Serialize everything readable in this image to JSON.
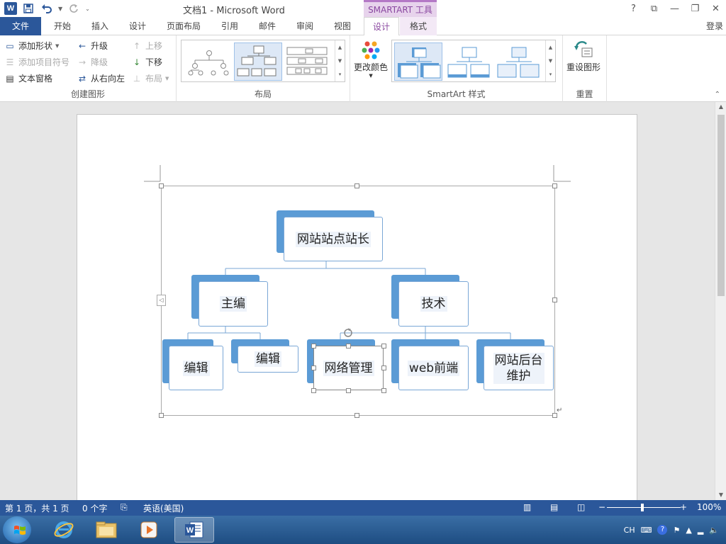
{
  "titlebar": {
    "doc_title": "文档1 - Microsoft Word",
    "context_tool_group": "SMARTART 工具",
    "controls": {
      "help": "?",
      "ribbon_display": "⧉",
      "minimize": "—",
      "restore": "❐",
      "close": "✕"
    }
  },
  "qat": {
    "word_logo": "W",
    "save_icon": "save-icon",
    "undo_icon": "undo-icon",
    "redo_icon": "redo-icon"
  },
  "tabs": {
    "file": "文件",
    "home": "开始",
    "insert": "插入",
    "design": "设计",
    "layout": "页面布局",
    "references": "引用",
    "mailings": "邮件",
    "review": "审阅",
    "view": "视图",
    "sa_design": "设计",
    "sa_format": "格式",
    "login": "登录"
  },
  "ribbon": {
    "create_graphic": {
      "add_shape": "添加形状",
      "add_bullet": "添加项目符号",
      "text_pane": "文本窗格",
      "promote": "升级",
      "demote": "降级",
      "right_to_left": "从右向左",
      "move_up": "上移",
      "move_down": "下移",
      "layout": "布局",
      "label": "创建图形"
    },
    "layouts_label": "布局",
    "change_colors": "更改颜色",
    "styles_label": "SmartArt 样式",
    "reset_graphic": "重设图形",
    "reset_label": "重置"
  },
  "smartart": {
    "root": "网站站点站长",
    "level1": [
      "主编",
      "技术"
    ],
    "editor_children": [
      "编辑",
      "编辑"
    ],
    "tech_children": [
      "网络管理",
      "web前端",
      "网站后台\n维护"
    ]
  },
  "status": {
    "page": "第 1 页，共 1 页",
    "words": "0 个字",
    "language": "英语(美国)",
    "zoom": "100%"
  },
  "taskbar": {
    "tray_lang": "CH"
  },
  "colors": {
    "accent": "#2b579a",
    "smartart_back": "#5b9bd5",
    "context_purple": "#8a48a0"
  }
}
